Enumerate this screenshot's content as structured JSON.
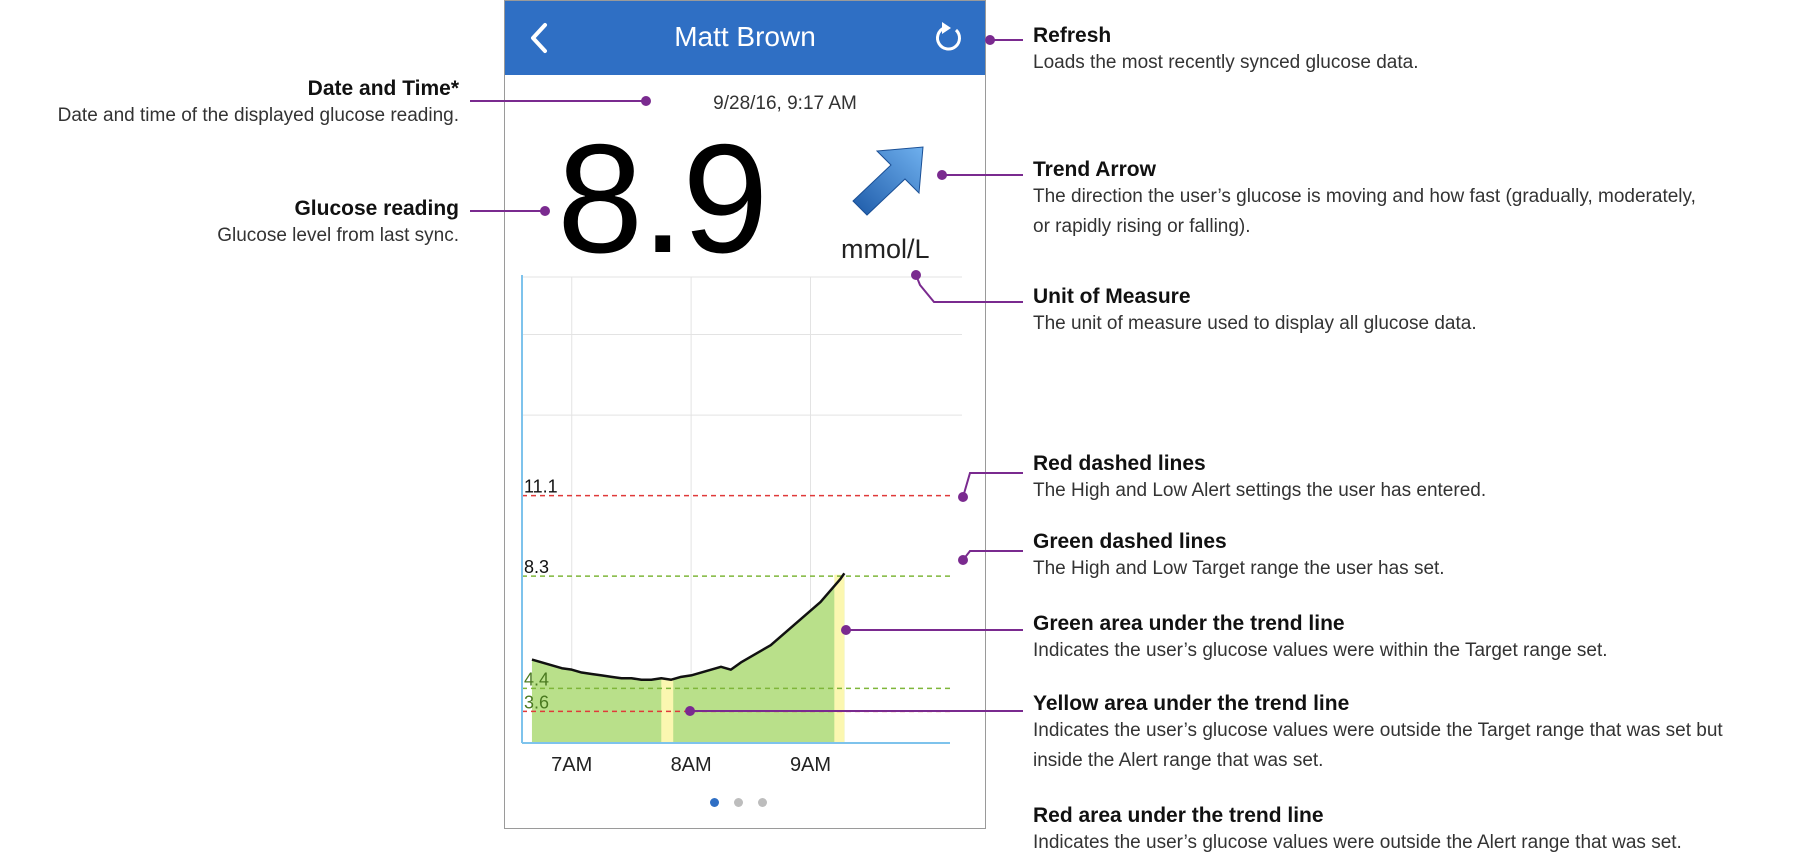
{
  "phone": {
    "title": "Matt Brown",
    "datetime": "9/28/16, 9:17 AM",
    "reading": "8.9",
    "unit": "mmol/L",
    "header_color": "#2f6fc4",
    "icons": {
      "back": "chevron-left-icon",
      "refresh": "refresh-icon",
      "trend": "trend-arrow-up-right-icon"
    },
    "page_dots": {
      "count": 3,
      "active": 0
    }
  },
  "chart_data": {
    "type": "area",
    "x_ticks": [
      "7AM",
      "8AM",
      "9AM"
    ],
    "reference_lines": [
      {
        "value": 11.1,
        "label": "11.1",
        "color": "#e03a3a",
        "style": "dashed"
      },
      {
        "value": 8.3,
        "label": "8.3",
        "color": "#7fb63a",
        "style": "dashed"
      },
      {
        "value": 4.4,
        "label": "4.4",
        "color": "#7fb63a",
        "style": "dashed"
      },
      {
        "value": 3.6,
        "label": "3.6",
        "color": "#e03a3a",
        "style": "dashed"
      }
    ],
    "series": [
      {
        "x": [
          "6:40",
          "6:45",
          "6:50",
          "6:55",
          "7:00",
          "7:05",
          "7:10",
          "7:15",
          "7:20",
          "7:25",
          "7:30",
          "7:35",
          "7:40",
          "7:45",
          "7:50",
          "7:55",
          "8:00",
          "8:05",
          "8:10",
          "8:15",
          "8:20",
          "8:25",
          "8:30",
          "8:35",
          "8:40",
          "8:45",
          "8:50",
          "8:55",
          "9:00",
          "9:05",
          "9:10",
          "9:15",
          "9:17"
        ],
        "y": [
          5.4,
          5.3,
          5.2,
          5.1,
          5.05,
          4.95,
          4.9,
          4.85,
          4.8,
          4.75,
          4.75,
          4.7,
          4.7,
          4.75,
          4.7,
          4.8,
          4.85,
          4.95,
          5.05,
          5.15,
          5.05,
          5.3,
          5.5,
          5.7,
          5.9,
          6.2,
          6.5,
          6.8,
          7.1,
          7.4,
          7.8,
          8.2,
          8.4
        ]
      }
    ],
    "area_colors": {
      "in_target": "#b9e08a",
      "outside_target": "#fbf7b0"
    }
  },
  "annotations": {
    "refresh": {
      "title": "Refresh",
      "desc": "Loads the most recently synced glucose data."
    },
    "datetime": {
      "title": "Date and Time*",
      "desc": "Date and time of the displayed glucose reading."
    },
    "trend": {
      "title": "Trend Arrow",
      "desc1": "The direction the user’s glucose is moving and how fast (gradually, moderately,",
      "desc2": "or rapidly rising or falling)."
    },
    "glucose": {
      "title": "Glucose reading",
      "desc": "Glucose level from last sync."
    },
    "unit": {
      "title": "Unit of Measure",
      "desc": "The unit of measure used to display all glucose data."
    },
    "red_lines": {
      "title": "Red dashed lines",
      "desc": "The High and Low Alert settings the user has entered."
    },
    "green_lines": {
      "title": "Green dashed lines",
      "desc": "The High and Low Target range the user has set."
    },
    "green_area": {
      "title": "Green area under the trend line",
      "desc": "Indicates the user’s glucose values were within the Target range set."
    },
    "yellow_area": {
      "title": "Yellow area under the trend line",
      "desc1": "Indicates the user’s glucose values were outside the Target range that was set but",
      "desc2": "inside the Alert range that was set."
    },
    "red_area": {
      "title": "Red area under the trend line",
      "desc": "Indicates the user’s glucose values were outside the Alert range that was set."
    }
  },
  "colors": {
    "leader": "#7a2a8f"
  }
}
